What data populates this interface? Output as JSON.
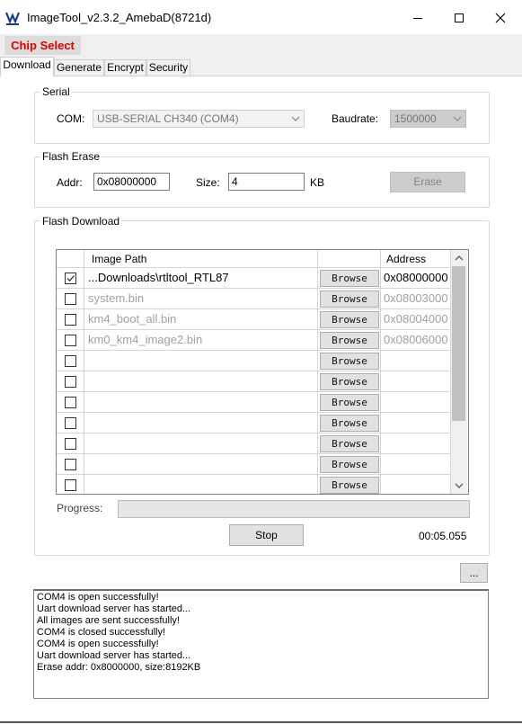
{
  "window": {
    "title": "ImageTool_v2.3.2_AmebaD(8721d)",
    "minimize_icon": "minimize-icon",
    "maximize_icon": "maximize-icon",
    "close_icon": "close-icon"
  },
  "chip_select": {
    "label": "Chip Select",
    "color": "#e00000"
  },
  "tabs": [
    {
      "label": "Download",
      "active": true
    },
    {
      "label": "Generate",
      "active": false
    },
    {
      "label": "Encrypt",
      "active": false
    },
    {
      "label": "Security",
      "active": false
    }
  ],
  "serial": {
    "group_label": "Serial",
    "com_label": "COM:",
    "com_value": "USB-SERIAL CH340 (COM4)",
    "baudrate_label": "Baudrate:",
    "baudrate_value": "1500000"
  },
  "flash_erase": {
    "group_label": "Flash Erase",
    "addr_label": "Addr:",
    "addr_value": "0x08000000",
    "size_label": "Size:",
    "size_value": "4",
    "size_unit": "KB",
    "erase_label": "Erase"
  },
  "flash_download": {
    "group_label": "Flash Download",
    "header_image": "Image Path",
    "header_address": "Address",
    "rows": [
      {
        "checked": true,
        "path": "Downloads\\rtltool_RTL87...",
        "browse": "Browse",
        "address": "0x08000000",
        "active": true
      },
      {
        "checked": false,
        "path": "system.bin",
        "browse": "Browse",
        "address": "0x08003000",
        "active": false
      },
      {
        "checked": false,
        "path": "km4_boot_all.bin",
        "browse": "Browse",
        "address": "0x08004000",
        "active": false
      },
      {
        "checked": false,
        "path": "km0_km4_image2.bin",
        "browse": "Browse",
        "address": "0x08006000",
        "active": false
      },
      {
        "checked": false,
        "path": "",
        "browse": "Browse",
        "address": "",
        "active": false
      },
      {
        "checked": false,
        "path": "",
        "browse": "Browse",
        "address": "",
        "active": false
      },
      {
        "checked": false,
        "path": "",
        "browse": "Browse",
        "address": "",
        "active": false
      },
      {
        "checked": false,
        "path": "",
        "browse": "Browse",
        "address": "",
        "active": false
      },
      {
        "checked": false,
        "path": "",
        "browse": "Browse",
        "address": "",
        "active": false
      },
      {
        "checked": false,
        "path": "",
        "browse": "Browse",
        "address": "",
        "active": false
      },
      {
        "checked": false,
        "path": "",
        "browse": "Browse",
        "address": "",
        "active": false
      }
    ],
    "progress_label": "Progress:",
    "progress_fraction": 0,
    "stop_label": "Stop",
    "elapsed": "00:05.055"
  },
  "more_button": {
    "label": "..."
  },
  "log": [
    "COM4 is open successfully!",
    "Uart download server has started...",
    "All images are sent successfully!",
    "COM4 is closed successfully!",
    "COM4 is open successfully!",
    "Uart download server has started...",
    "Erase addr: 0x8000000, size:8192KB"
  ]
}
